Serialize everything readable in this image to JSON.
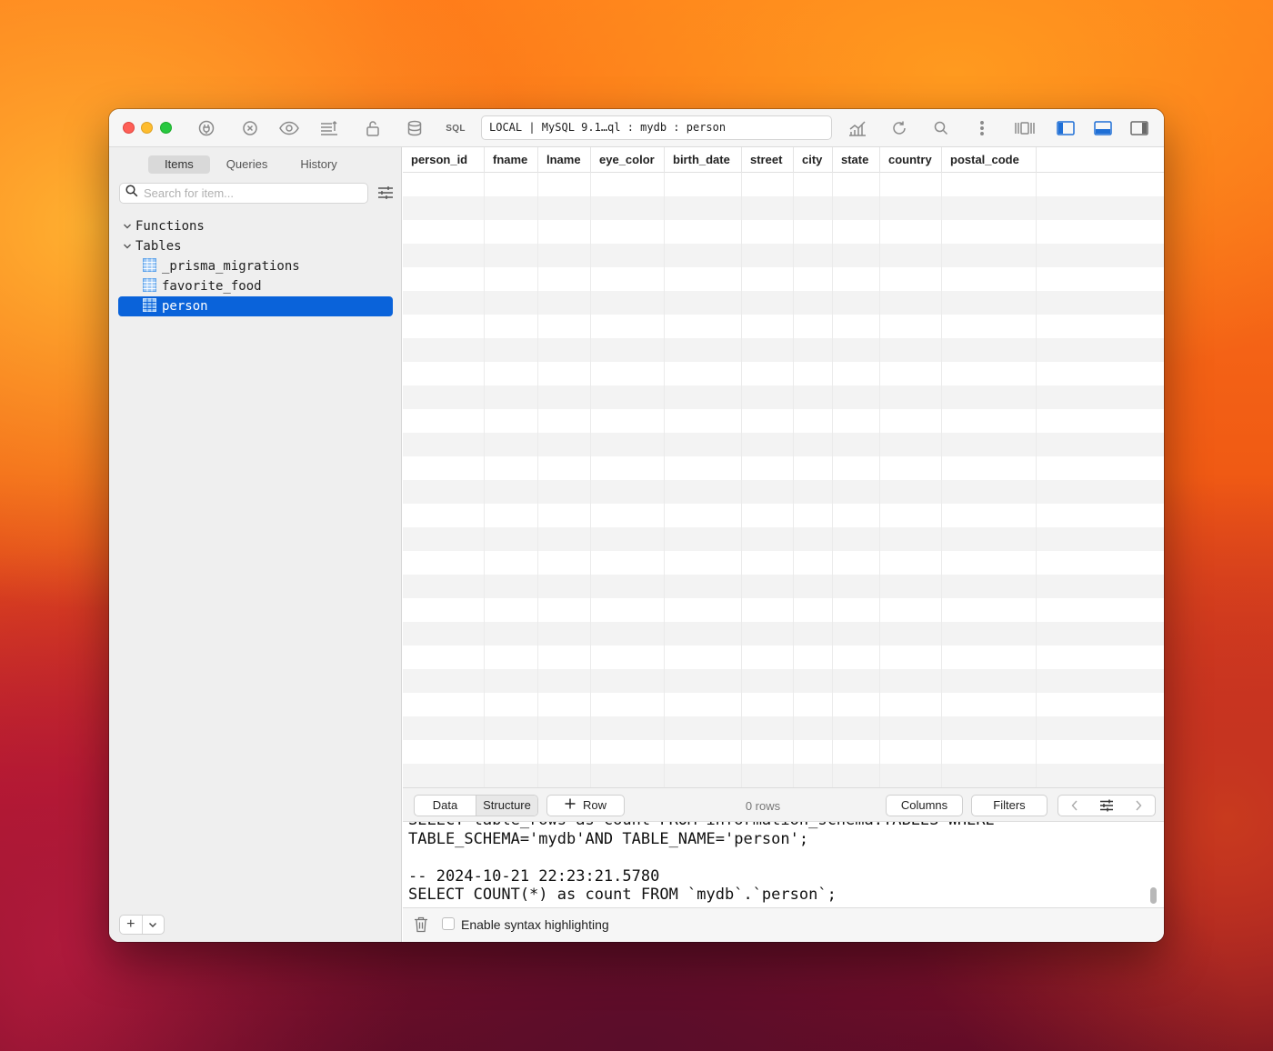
{
  "toolbar": {
    "sql_label": "SQL",
    "connection_path": "LOCAL | MySQL 9.1…ql : mydb : person"
  },
  "sidebar": {
    "tabs": [
      {
        "label": "Items",
        "active": true
      },
      {
        "label": "Queries",
        "active": false
      },
      {
        "label": "History",
        "active": false
      }
    ],
    "search_placeholder": "Search for item...",
    "groups": [
      {
        "label": "Functions",
        "expanded": false
      },
      {
        "label": "Tables",
        "expanded": true
      }
    ],
    "tables": [
      {
        "label": "_prisma_migrations",
        "selected": false
      },
      {
        "label": "favorite_food",
        "selected": false
      },
      {
        "label": "person",
        "selected": true
      }
    ],
    "footer": {
      "add": "+",
      "menu": "⌄"
    }
  },
  "grid": {
    "columns": [
      "person_id",
      "fname",
      "lname",
      "eye_color",
      "birth_date",
      "street",
      "city",
      "state",
      "country",
      "postal_code"
    ],
    "rows": []
  },
  "bottom_bar": {
    "data_label": "Data",
    "structure_label": "Structure",
    "add_row_label": "Row",
    "row_count": "0 rows",
    "columns_label": "Columns",
    "filters_label": "Filters"
  },
  "log": {
    "lines": [
      "SELECT table_rows as count FROM information_schema.TABLES WHERE",
      "TABLE_SCHEMA='mydb'AND TABLE_NAME='person';",
      "",
      "-- 2024-10-21 22:23:21.5780",
      "SELECT COUNT(*) as count FROM `mydb`.`person`;"
    ],
    "syntax_highlight_label": "Enable syntax highlighting",
    "syntax_highlight_checked": false
  },
  "colors": {
    "accent": "#0a63da",
    "selection": "#0a63da",
    "traffic_red": "#fe5f57",
    "traffic_yellow": "#febc2e",
    "traffic_green": "#28c840"
  }
}
